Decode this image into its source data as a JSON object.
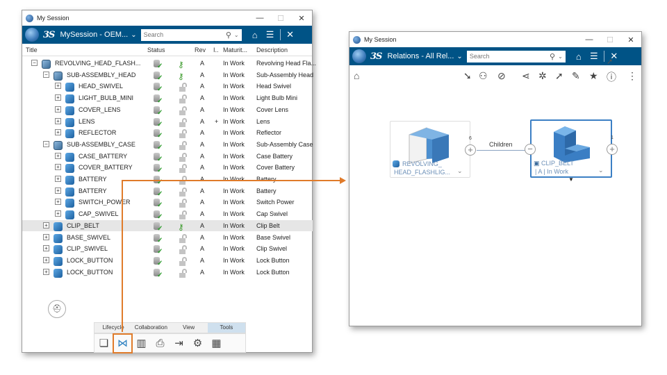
{
  "session_window": {
    "title": "My Session",
    "session_name": "MySession - OEM...",
    "search_placeholder": "Search",
    "columns": [
      "Title",
      "Status",
      "Rev",
      "I..",
      "Maturit...",
      "Description"
    ],
    "rows": [
      {
        "title": "REVOLVING_HEAD_FLASH...",
        "rev": "A",
        "ind": "",
        "maturity": "In Work",
        "desc": "Revolving Head Fla...",
        "level": 0,
        "exp": "−",
        "asm": true,
        "key": true
      },
      {
        "title": "SUB-ASSEMBLY_HEAD",
        "rev": "A",
        "ind": "",
        "maturity": "In Work",
        "desc": "Sub-Assembly Head",
        "level": 1,
        "exp": "−",
        "asm": true,
        "key": true
      },
      {
        "title": "HEAD_SWIVEL",
        "rev": "A",
        "ind": "",
        "maturity": "In Work",
        "desc": "Head Swivel",
        "level": 2,
        "exp": "+",
        "asm": false,
        "key": false
      },
      {
        "title": "LIGHT_BULB_MINI",
        "rev": "A",
        "ind": "",
        "maturity": "In Work",
        "desc": "Light Bulb Mini",
        "level": 2,
        "exp": "+",
        "asm": false,
        "key": false
      },
      {
        "title": "COVER_LENS",
        "rev": "A",
        "ind": "",
        "maturity": "In Work",
        "desc": "Cover Lens",
        "level": 2,
        "exp": "+",
        "asm": false,
        "key": false
      },
      {
        "title": "LENS",
        "rev": "A",
        "ind": "+",
        "maturity": "In Work",
        "desc": "Lens",
        "level": 2,
        "exp": "+",
        "asm": false,
        "key": false
      },
      {
        "title": "REFLECTOR",
        "rev": "A",
        "ind": "",
        "maturity": "In Work",
        "desc": "Reflector",
        "level": 2,
        "exp": "+",
        "asm": false,
        "key": false
      },
      {
        "title": "SUB-ASSEMBLY_CASE",
        "rev": "A",
        "ind": "",
        "maturity": "In Work",
        "desc": "Sub-Assembly Case",
        "level": 1,
        "exp": "−",
        "asm": true,
        "key": false
      },
      {
        "title": "CASE_BATTERY",
        "rev": "A",
        "ind": "",
        "maturity": "In Work",
        "desc": "Case Battery",
        "level": 2,
        "exp": "+",
        "asm": false,
        "key": false
      },
      {
        "title": "COVER_BATTERY",
        "rev": "A",
        "ind": "",
        "maturity": "In Work",
        "desc": "Cover Battery",
        "level": 2,
        "exp": "+",
        "asm": false,
        "key": false
      },
      {
        "title": "BATTERY",
        "rev": "A",
        "ind": "",
        "maturity": "In Work",
        "desc": "Battery",
        "level": 2,
        "exp": "+",
        "asm": false,
        "key": false
      },
      {
        "title": "BATTERY",
        "rev": "A",
        "ind": "",
        "maturity": "In Work",
        "desc": "Battery",
        "level": 2,
        "exp": "+",
        "asm": false,
        "key": false
      },
      {
        "title": "SWITCH_POWER",
        "rev": "A",
        "ind": "",
        "maturity": "In Work",
        "desc": "Switch Power",
        "level": 2,
        "exp": "+",
        "asm": false,
        "key": false
      },
      {
        "title": "CAP_SWIVEL",
        "rev": "A",
        "ind": "",
        "maturity": "In Work",
        "desc": "Cap Swivel",
        "level": 2,
        "exp": "+",
        "asm": false,
        "key": false
      },
      {
        "title": "CLIP_BELT",
        "rev": "A",
        "ind": "",
        "maturity": "In Work",
        "desc": "Clip Belt",
        "level": 1,
        "exp": "+",
        "asm": false,
        "key": true,
        "selected": true
      },
      {
        "title": "BASE_SWIVEL",
        "rev": "A",
        "ind": "",
        "maturity": "In Work",
        "desc": "Base Swivel",
        "level": 1,
        "exp": "+",
        "asm": false,
        "key": false
      },
      {
        "title": "CLIP_SWIVEL",
        "rev": "A",
        "ind": "",
        "maturity": "In Work",
        "desc": "Clip Swivel",
        "level": 1,
        "exp": "+",
        "asm": false,
        "key": false
      },
      {
        "title": "LOCK_BUTTON",
        "rev": "A",
        "ind": "",
        "maturity": "In Work",
        "desc": "Lock Button",
        "level": 1,
        "exp": "+",
        "asm": false,
        "key": false
      },
      {
        "title": "LOCK_BUTTON",
        "rev": "A",
        "ind": "",
        "maturity": "In Work",
        "desc": "Lock Button",
        "level": 1,
        "exp": "+",
        "asm": false,
        "key": false
      }
    ],
    "bottom_tabs": [
      "Lifecycle",
      "Collaboration",
      "View",
      "Tools"
    ],
    "active_tab": "Tools",
    "accent": "#005386",
    "highlight": "#e07b2a"
  },
  "relations_window": {
    "title": "My Session",
    "panel_name": "Relations - All Rel...",
    "search_placeholder": "Search",
    "source_node": {
      "line1": "REVOLVING_",
      "line2": "HEAD_FLASHLIG...",
      "count": "6"
    },
    "edge_label": "Children",
    "target_node": {
      "line1": "CLIP_BELT",
      "line2": "| A | In Work",
      "count": "1"
    }
  }
}
